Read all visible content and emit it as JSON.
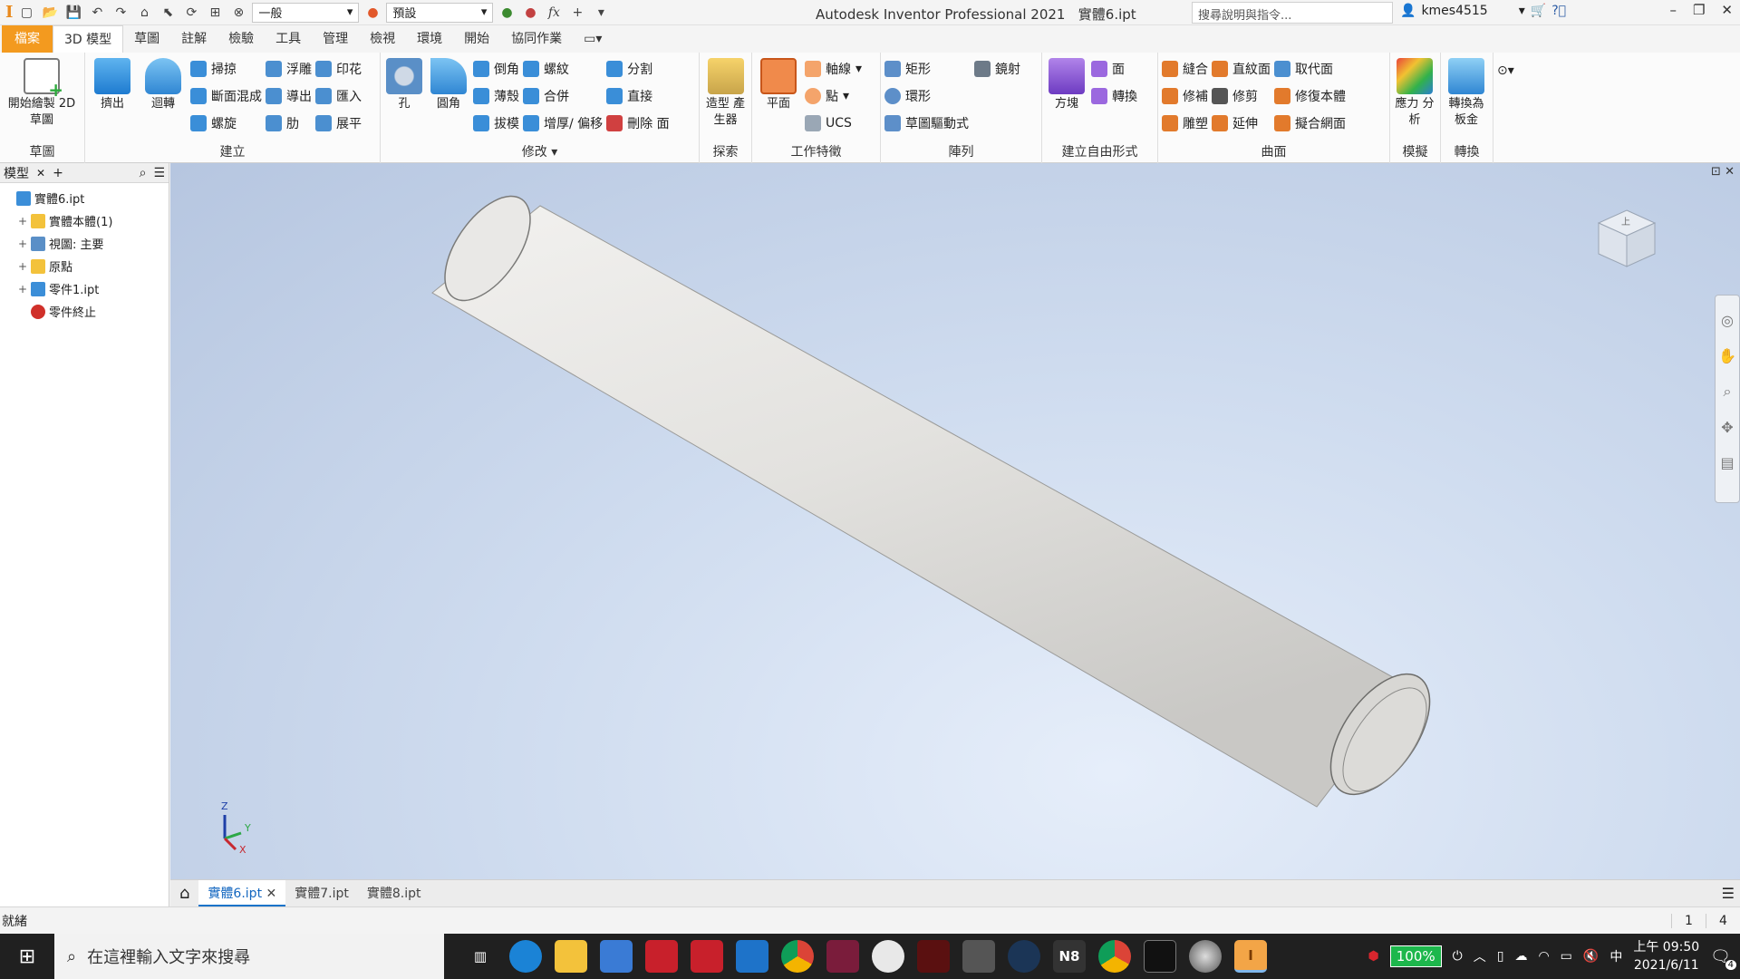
{
  "app": {
    "title": "Autodesk Inventor Professional 2021",
    "document": "實體6.ipt",
    "logo": "I"
  },
  "quick_access": {
    "appearance_combo": "一般",
    "material_combo": "預設",
    "fx": "fx"
  },
  "help_search": {
    "placeholder": "搜尋說明與指令..."
  },
  "user": {
    "name": "kmes4515"
  },
  "ribbon_tabs": [
    "檔案",
    "3D 模型",
    "草圖",
    "註解",
    "檢驗",
    "工具",
    "管理",
    "檢視",
    "環境",
    "開始",
    "協同作業"
  ],
  "ribbon": {
    "sketch": {
      "title": "草圖",
      "start_sketch": "開始繪製 2D 草圖"
    },
    "create": {
      "title": "建立",
      "extrude": "擠出",
      "revolve": "迴轉",
      "sweep": "掃掠",
      "loft": "斷面混成",
      "coil": "螺旋",
      "emboss": "浮雕",
      "derive": "導出",
      "rib": "肋",
      "decal": "印花",
      "import": "匯入",
      "unfold": "展平"
    },
    "modify": {
      "title": "修改",
      "hole": "孔",
      "fillet": "圓角",
      "chamfer": "倒角",
      "shell": "薄殼",
      "draft": "拔模",
      "thread": "螺紋",
      "combine": "合併",
      "thicken": "增厚/ 偏移",
      "split": "分割",
      "direct": "直接",
      "delete_face": "刪除 面"
    },
    "explore": {
      "title": "探索",
      "shape_generator": "造型 產生器"
    },
    "work_features": {
      "title": "工作特徵",
      "plane": "平面",
      "axis": "軸線",
      "point": "點",
      "ucs": "UCS"
    },
    "pattern": {
      "title": "陣列",
      "rect": "矩形",
      "circular": "環形",
      "sketch_driven": "草圖驅動式",
      "mirror": "鏡射"
    },
    "freeform": {
      "title": "建立自由形式",
      "box": "方塊",
      "face": "面",
      "convert": "轉換"
    },
    "surface": {
      "title": "曲面",
      "stitch": "縫合",
      "patch": "修補",
      "sculpt": "雕塑",
      "ruled": "直紋面",
      "trim": "修剪",
      "extend": "延伸",
      "replace_face": "取代面",
      "repair": "修復本體",
      "fit_mesh": "擬合網面"
    },
    "simulation": {
      "title": "模擬",
      "stress": "應力 分析"
    },
    "convert": {
      "title": "轉換",
      "sheet_metal": "轉換為 板金"
    }
  },
  "browser": {
    "tab": "模型",
    "tree": [
      {
        "label": "實體6.ipt",
        "expander": "",
        "indent": 0,
        "icon": "part-icon"
      },
      {
        "label": "實體本體(1)",
        "expander": "+",
        "indent": 1,
        "icon": "folder-icon"
      },
      {
        "label": "視圖: 主要",
        "expander": "+",
        "indent": 1,
        "icon": "view-icon"
      },
      {
        "label": "原點",
        "expander": "+",
        "indent": 1,
        "icon": "folder-icon"
      },
      {
        "label": "零件1.ipt",
        "expander": "+",
        "indent": 1,
        "icon": "part-icon"
      },
      {
        "label": "零件終止",
        "expander": "",
        "indent": 1,
        "icon": "end-of-part-icon"
      }
    ]
  },
  "axes": {
    "z": "Z",
    "y": "Y",
    "x": "X"
  },
  "viewcube": {
    "label": "上"
  },
  "doc_tabs": [
    "實體6.ipt",
    "實體7.ipt",
    "實體8.ipt"
  ],
  "status": {
    "text": "就緒",
    "n1": "1",
    "n2": "4"
  },
  "taskbar": {
    "search_placeholder": "在這裡輸入文字來搜尋",
    "battery": "100%",
    "ime": "中",
    "time": "上午 09:50",
    "date": "2021/6/11",
    "notif_count": "4"
  },
  "colors": {
    "file_tab": "#f39a1f",
    "accent": "#1a73c9",
    "viewport_center": "#e6eefa",
    "viewport_edge": "#b6c6e0"
  }
}
